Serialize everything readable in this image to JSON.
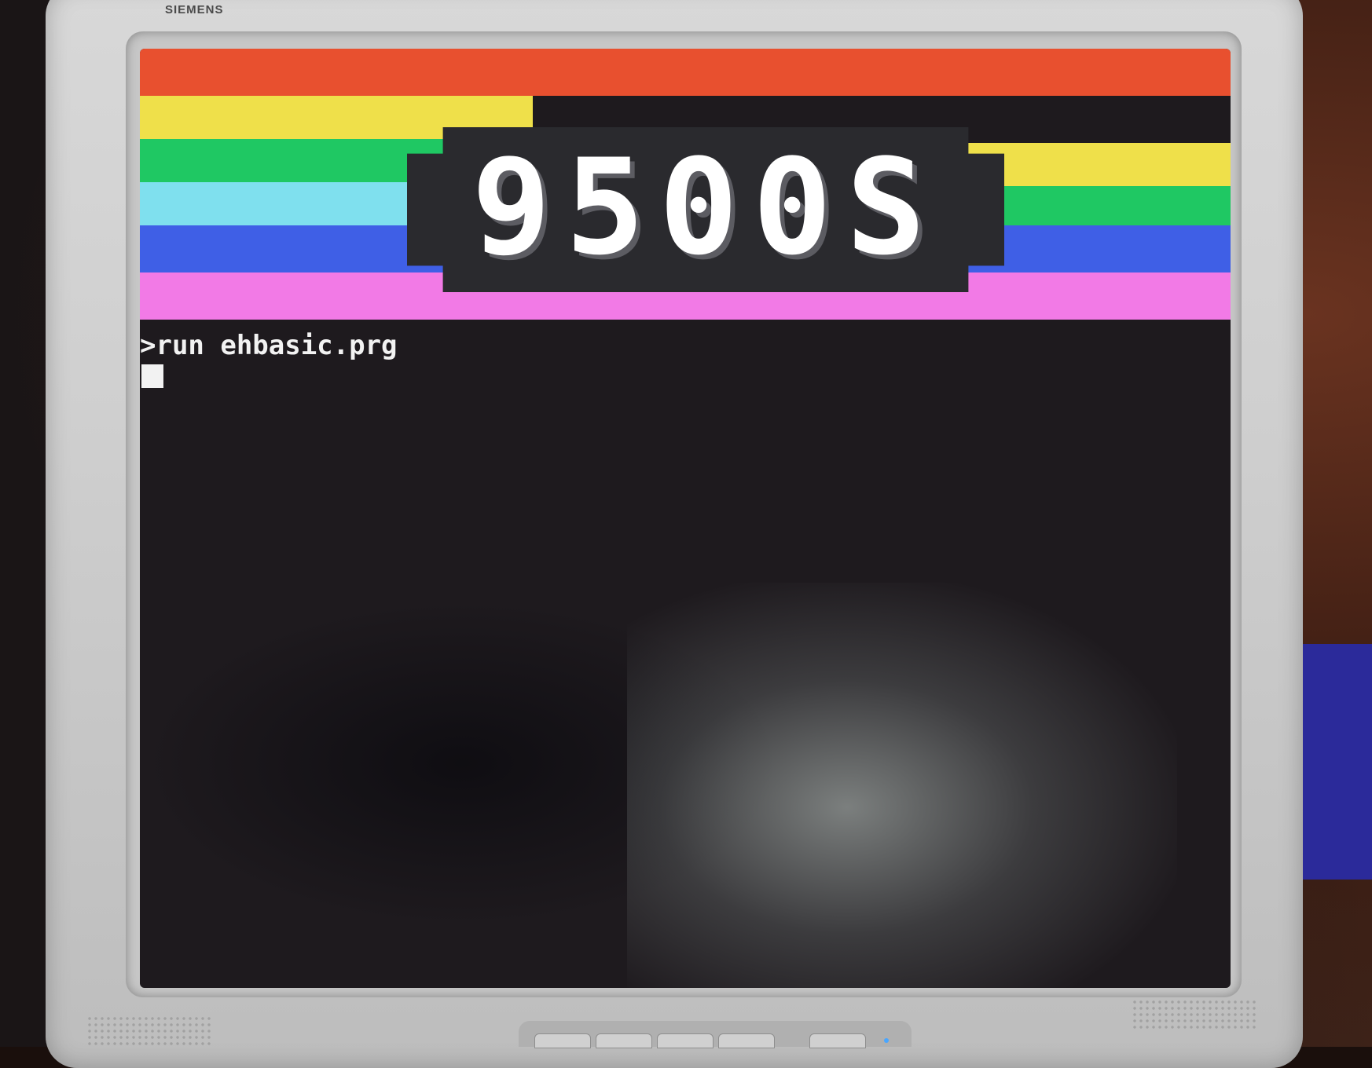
{
  "monitor": {
    "brand": "SIEMENS"
  },
  "screen": {
    "banner_colors": [
      "#e8502f",
      "#efe04a",
      "#1fc863",
      "#7fe0ee",
      "#3f5fe6",
      "#f27ae6"
    ],
    "logo_text": "9500S",
    "prompt_line": ">run ehbasic.prg"
  }
}
